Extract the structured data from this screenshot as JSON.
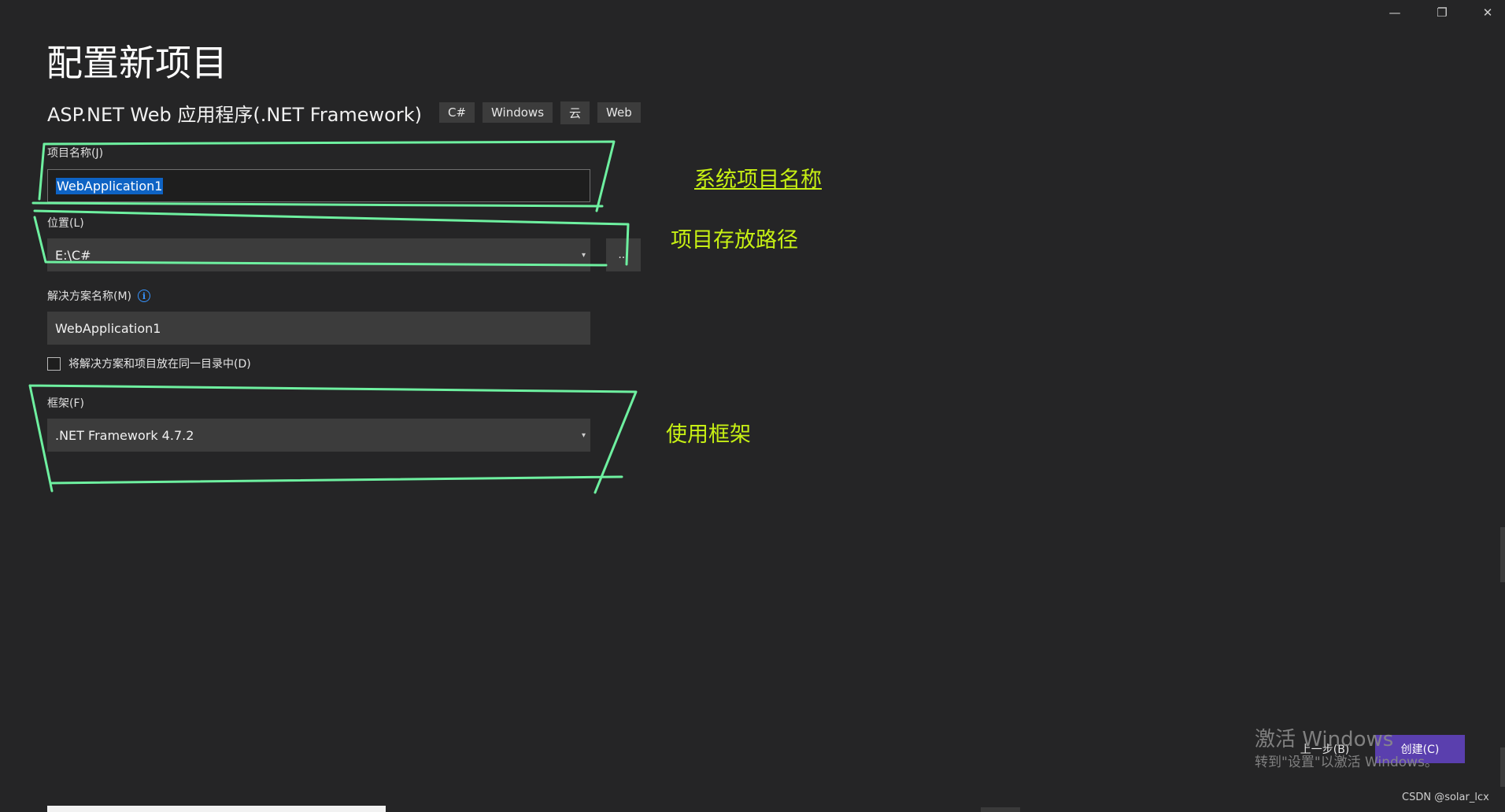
{
  "window": {
    "minimize_icon": "minimize-icon",
    "minimize_glyph": "—",
    "restore_icon": "restore-icon",
    "restore_glyph": "❐",
    "close_icon": "close-icon",
    "close_glyph": "✕"
  },
  "page": {
    "title": "配置新项目"
  },
  "template": {
    "name": "ASP.NET Web 应用程序(.NET Framework)",
    "tags": [
      "C#",
      "Windows",
      "云",
      "Web"
    ]
  },
  "project_name": {
    "label": "项目名称(J)",
    "value": "WebApplication1"
  },
  "location": {
    "label": "位置(L)",
    "value": "E:\\C#",
    "dropdown_glyph": "▾",
    "browse_label": "..."
  },
  "solution_name": {
    "label": "解决方案名称(M)",
    "info_glyph": "i",
    "value": "WebApplication1"
  },
  "same_directory": {
    "label": "将解决方案和项目放在同一目录中(D)",
    "checked": false
  },
  "framework": {
    "label": "框架(F)",
    "value": ".NET Framework 4.7.2",
    "dropdown_glyph": "▾"
  },
  "annotations": {
    "project_name_note": "系统项目名称",
    "location_note": "项目存放路径",
    "framework_note": "使用框架",
    "color": "#c7f014",
    "highlight_color": "#6ef0a0"
  },
  "watermark": {
    "title": "激活 Windows",
    "subtitle": "转到\"设置\"以激活 Windows。"
  },
  "footer": {
    "back_label": "上一步(B)",
    "create_label": "创建(C)",
    "create_color": "#5a3fae"
  },
  "credit": "CSDN @solar_lcx"
}
